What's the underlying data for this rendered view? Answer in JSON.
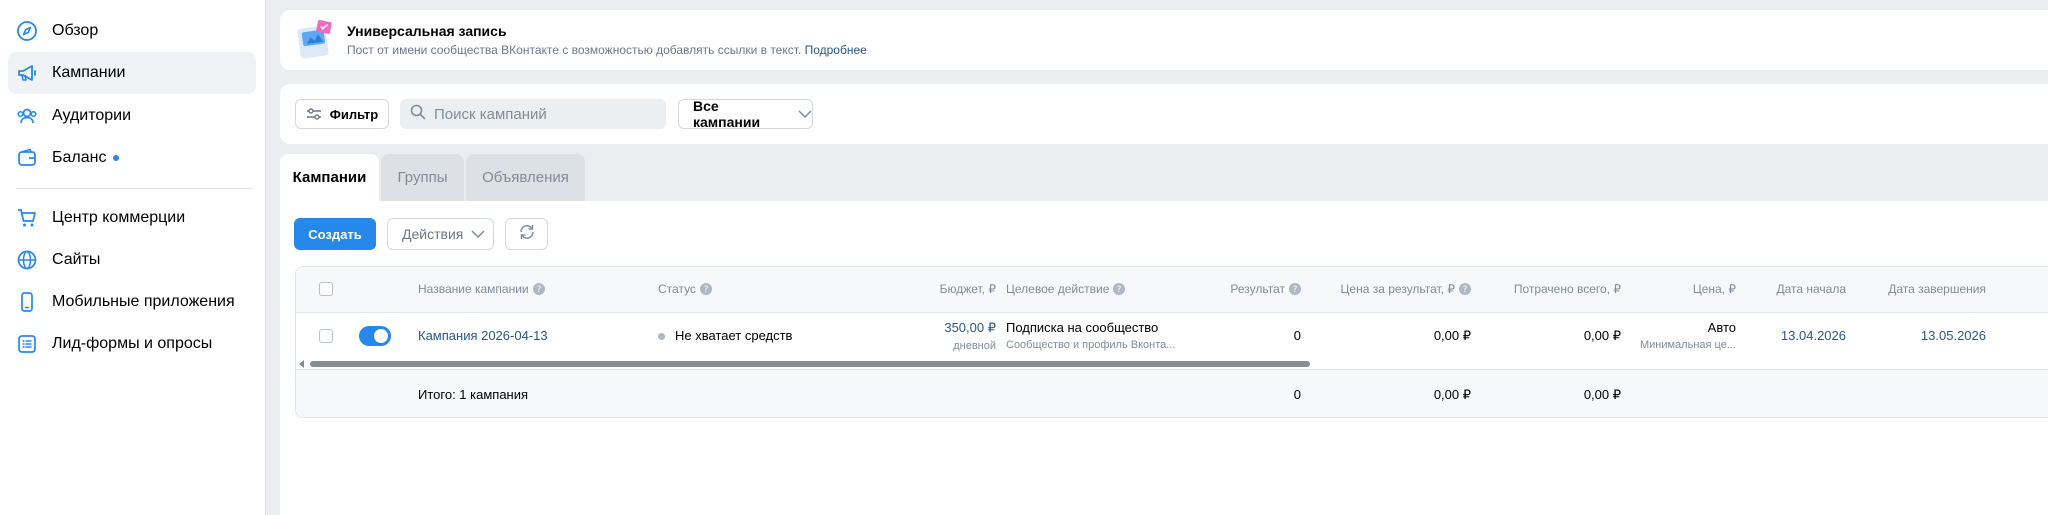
{
  "sidebar": {
    "items": [
      {
        "label": "Обзор",
        "icon": "compass-icon"
      },
      {
        "label": "Кампании",
        "icon": "megaphone-icon",
        "active": true
      },
      {
        "label": "Аудитории",
        "icon": "users-icon"
      },
      {
        "label": "Баланс",
        "icon": "wallet-icon",
        "dot": true
      },
      {
        "label": "Центр коммерции",
        "icon": "cart-icon"
      },
      {
        "label": "Сайты",
        "icon": "globe-icon"
      },
      {
        "label": "Мобильные приложения",
        "icon": "phone-icon"
      },
      {
        "label": "Лид-формы и опросы",
        "icon": "form-icon"
      }
    ]
  },
  "banner": {
    "title": "Универсальная запись",
    "subtitle": "Пост от имени сообщества ВКонтакте с возможностью добавлять ссылки в текст.",
    "link": "Подробнее"
  },
  "filterbar": {
    "filter_label": "Фильтр",
    "search_placeholder": "Поиск кампаний",
    "select_value": "Все кампании"
  },
  "tabs": [
    {
      "label": "Кампании",
      "active": true
    },
    {
      "label": "Группы"
    },
    {
      "label": "Объявления"
    }
  ],
  "toolbar": {
    "create_label": "Создать",
    "actions_label": "Действия"
  },
  "table": {
    "columns": {
      "name": "Название кампании",
      "status": "Статус",
      "budget": "Бюджет, ₽",
      "target": "Целевое действие",
      "result": "Результат",
      "cpr": "Цена за результат, ₽",
      "spent": "Потрачено всего, ₽",
      "price": "Цена, ₽",
      "start": "Дата начала",
      "end": "Дата завершения"
    },
    "rows": [
      {
        "name": "Кампания 2026-04-13",
        "status": "Не хватает средств",
        "budget": "350,00 ₽",
        "budget_sub": "дневной",
        "target": "Подписка на сообщество",
        "target_sub": "Сообщество и профиль Вконта...",
        "result": "0",
        "cpr": "0,00 ₽",
        "spent": "0,00 ₽",
        "price": "Авто",
        "price_sub": "Минимальная це...",
        "start": "13.04.2026",
        "end": "13.05.2026",
        "enabled": true
      }
    ],
    "footer": {
      "label": "Итого: 1 кампания",
      "result": "0",
      "cpr": "0,00 ₽",
      "spent": "0,00 ₽"
    }
  },
  "colors": {
    "accent": "#2688eb",
    "link": "#2a5885",
    "background": "#ebedf0"
  }
}
